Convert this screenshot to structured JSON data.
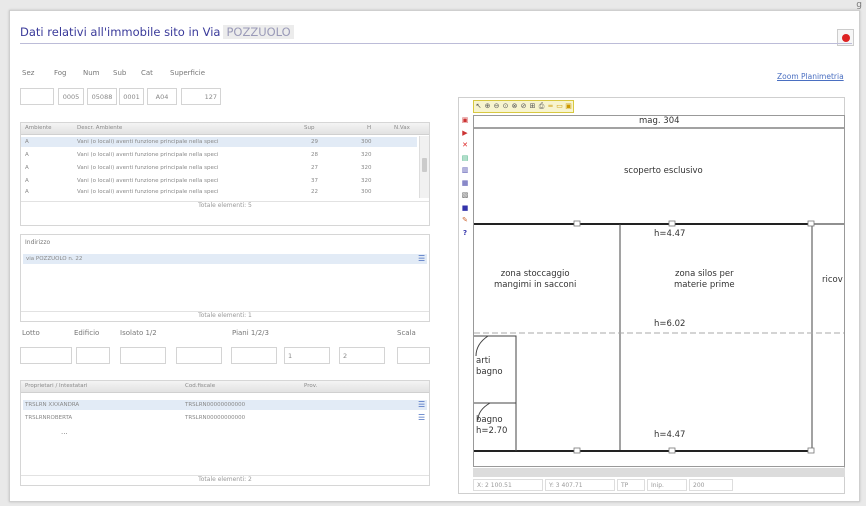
{
  "corner_text": "g",
  "header": {
    "title": "Dati relativi all'immobile sito in Via",
    "address": "POZZUOLO"
  },
  "zoom_link": "Zoom Planimetria",
  "fields": {
    "labels": [
      "Sez",
      "Fog",
      "Num",
      "Sub",
      "Cat",
      "Superficie"
    ],
    "values": [
      "",
      "0005",
      "05088",
      "0001",
      "A04",
      "127"
    ]
  },
  "ambienti": {
    "headers": [
      "Ambiente",
      "Descr. Ambiente",
      "Sup",
      "H",
      "N.Vax"
    ],
    "rows": [
      [
        "A",
        "Vani (o locali) aventi funzione principale nella speci",
        "29",
        "300"
      ],
      [
        "A",
        "Vani (o locali) aventi funzione principale nella speci",
        "28",
        "320"
      ],
      [
        "A",
        "Vani (o locali) aventi funzione principale nella speci",
        "27",
        "320"
      ],
      [
        "A",
        "Vani (o locali) aventi funzione principale nella speci",
        "37",
        "320"
      ],
      [
        "A",
        "Vani (o locali) aventi funzione principale nella speci",
        "22",
        "300"
      ]
    ],
    "total": "Totale elementi: 5"
  },
  "indirizzo": {
    "label": "Indirizzo",
    "rows": [
      "via POZZUOLO n. 22"
    ],
    "total": "Totale elementi: 1"
  },
  "locazione": {
    "labels": [
      "Lotto",
      "Edificio",
      "Isolato 1/2",
      "Piani 1/2/3",
      "Scala"
    ],
    "values": [
      "",
      "",
      "",
      "",
      "",
      "1",
      "2",
      ""
    ]
  },
  "intestatari": {
    "headers": [
      "Proprietari / Intestatari",
      "Cod.fiscale",
      "Prov."
    ],
    "rows": [
      [
        "TRSLRN XXXANDRA",
        "TRSLRN00000000000"
      ],
      [
        "TRSLRNROBERTA",
        "TRSLRN00000000000"
      ]
    ],
    "extra": "...",
    "total": "Totale elementi: 2"
  },
  "viewer": {
    "toolbar_icons": [
      "pan",
      "zoom-in",
      "zoom-out",
      "zoom-window",
      "zoom-extent",
      "zoom-prev",
      "zoom-fit",
      "print",
      "measure",
      "open",
      "save"
    ],
    "side_icons": [
      {
        "glyph": "▣",
        "color": "#c33"
      },
      {
        "glyph": "▶",
        "color": "#c33"
      },
      {
        "glyph": "✕",
        "color": "#d22"
      },
      {
        "glyph": "▤",
        "color": "#3a7"
      },
      {
        "glyph": "▥",
        "color": "#44a"
      },
      {
        "glyph": "▦",
        "color": "#44a"
      },
      {
        "glyph": "▧",
        "color": "#555"
      },
      {
        "glyph": "■",
        "color": "#33a"
      },
      {
        "glyph": "✎",
        "color": "#c63"
      },
      {
        "glyph": "?",
        "color": "#33a"
      }
    ],
    "plan_labels": {
      "top": "mag. 304",
      "scoperto": "scoperto esclusivo",
      "h1": "h=4.47",
      "zona1": "zona stoccaggio\nmangimi in sacconi",
      "zona2": "zona silos per\nmaterie prime",
      "ricov": "ricov",
      "h2": "h=6.02",
      "arti": "arti\nbagno",
      "bagno": "bagno\nh=2.70",
      "h3": "h=4.47"
    },
    "status": [
      "X: 2 100.51",
      "Y: 3 407.71",
      "TP",
      "Inip.",
      "200"
    ]
  }
}
